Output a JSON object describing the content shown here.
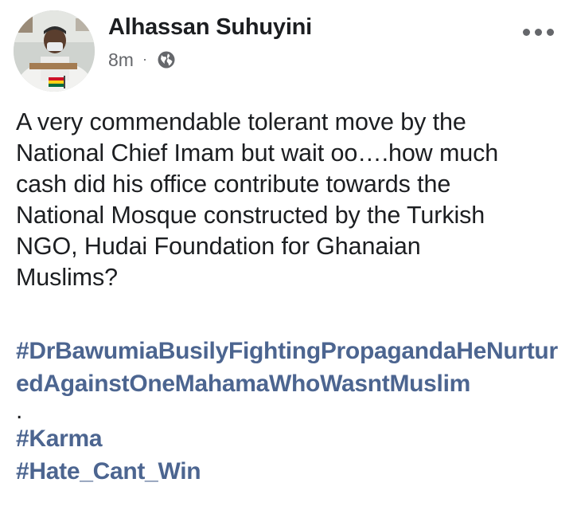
{
  "post": {
    "author_name": "Alhassan Suhuyini",
    "timestamp": "8m",
    "meta_separator": "·",
    "privacy_icon": "globe-icon",
    "more_icon": "more-options-icon",
    "body_lines": [
      "A very commendable tolerant move by the",
      "National Chief Imam but wait oo….how much",
      "cash did his office contribute towards the",
      "National Mosque constructed by the Turkish",
      "NGO, Hudai Foundation for Ghanaian",
      "Muslims?"
    ],
    "hashtags": {
      "main": "#DrBawumiaBusilyFightingPropagandaHeNurturedAgainstOneMahamaWhoWasntMuslim",
      "separator": ".",
      "karma": "#Karma",
      "hate": "#Hate_Cant_Win"
    }
  },
  "colors": {
    "text": "#1c1e21",
    "meta": "#65676b",
    "hashtag": "#4c6590",
    "background": "#ffffff"
  }
}
